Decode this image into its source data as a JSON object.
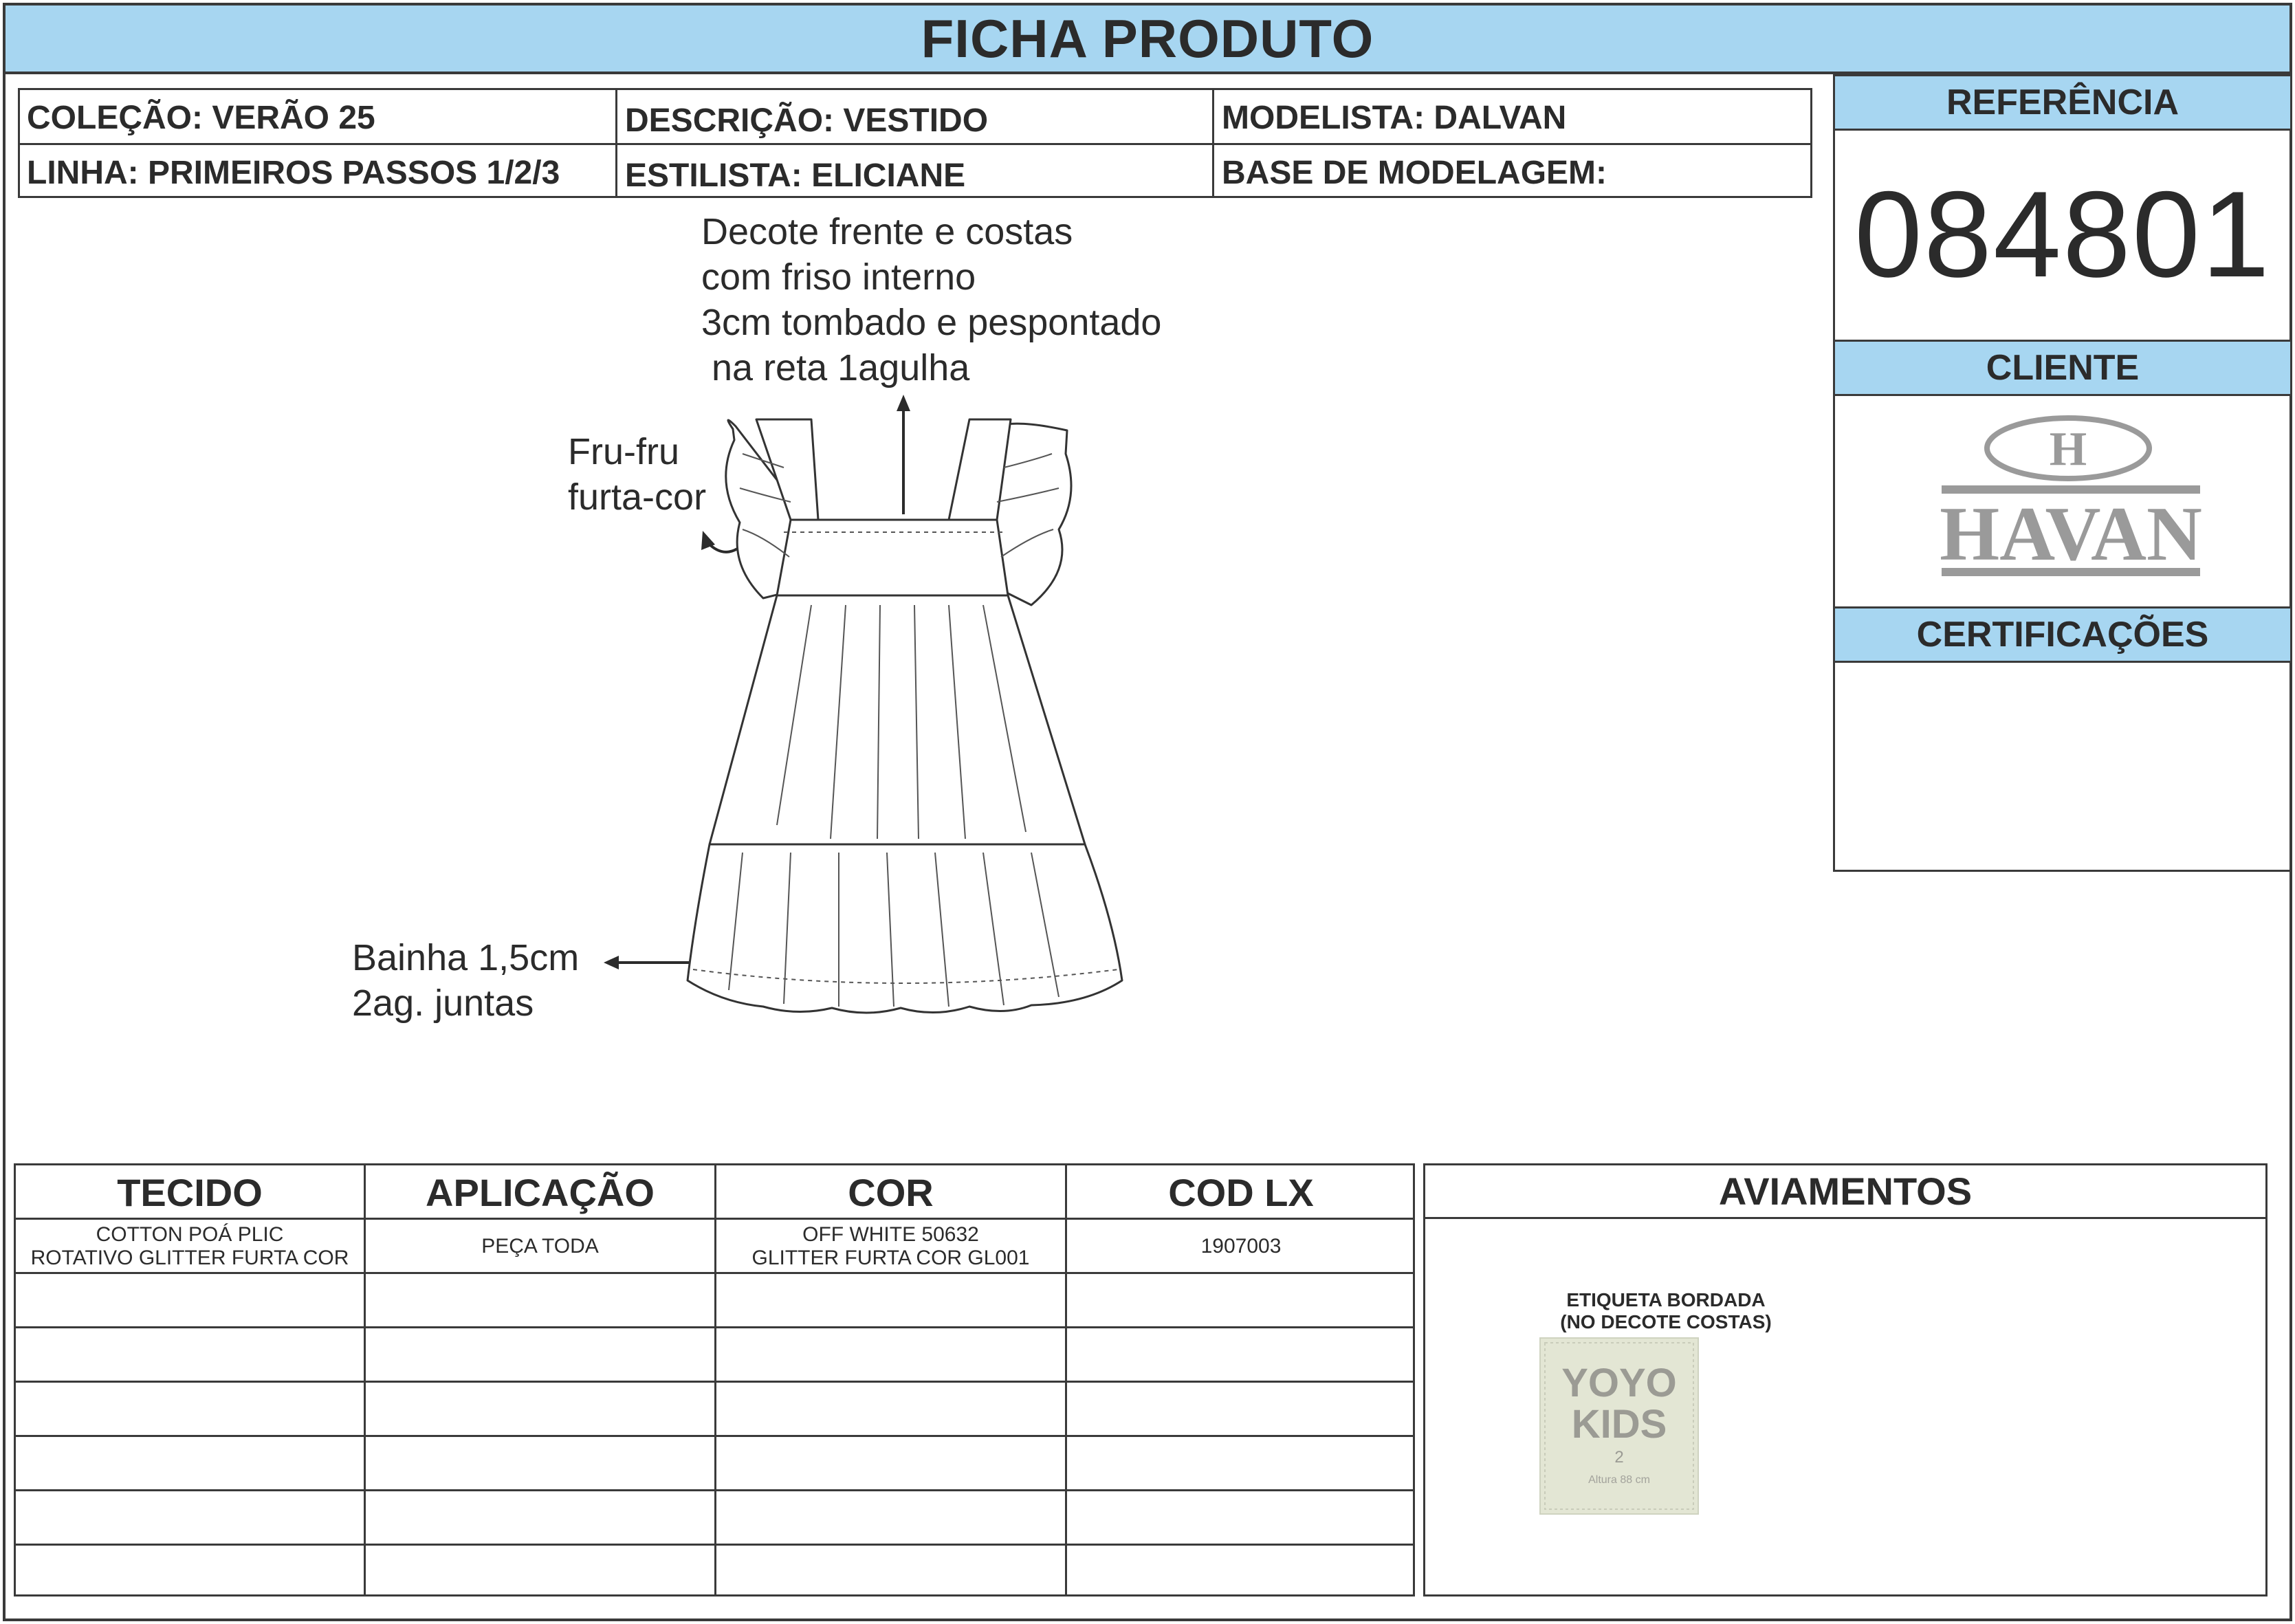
{
  "header": {
    "title": "FICHA PRODUTO"
  },
  "info": {
    "colecao": "COLEÇÃO: VERÃO 25",
    "descricao": "DESCRIÇÃO: VESTIDO",
    "modelista": "MODELISTA: DALVAN",
    "linha": "LINHA: PRIMEIROS PASSOS 1/2/3",
    "estilista": "ESTILISTA: ELICIANE",
    "base": "BASE DE MODELAGEM:"
  },
  "right_panel": {
    "referencia_label": "REFERÊNCIA",
    "referencia_value": "084801",
    "cliente_label": "CLIENTE",
    "cliente_logo_letter": "H",
    "cliente_logo_name": "HAVAN",
    "certificacoes_label": "CERTIFICAÇÕES"
  },
  "annotations": {
    "decote": "Decote frente e costas\ncom friso interno\n3cm tombado e pespontado\n na reta 1agulha",
    "frufru": "Fru-fru\nfurta-cor",
    "bainha": "Bainha 1,5cm\n2ag. juntas"
  },
  "materials_table": {
    "headers": [
      "TECIDO",
      "APLICAÇÃO",
      "COR",
      "COD LX"
    ],
    "rows": [
      [
        "COTTON POÁ PLIC\nROTATIVO GLITTER FURTA COR",
        "PEÇA TODA",
        "OFF WHITE 50632\nGLITTER FURTA COR GL001",
        "1907003"
      ]
    ]
  },
  "aviamentos": {
    "title": "AVIAMENTOS",
    "item_caption": "ETIQUETA BORDADA\n(NO DECOTE COSTAS)",
    "label_brand_1": "YOYO",
    "label_brand_2": "KIDS",
    "label_size": "2",
    "label_height": "Altura 88 cm"
  },
  "colors": {
    "header_blue": "#a7d6f1",
    "border": "#3a3a3a",
    "logo_gray": "#9a9a9a"
  },
  "icons": [
    "arrow-up-icon",
    "curved-arrow-icon",
    "arrow-left-icon"
  ]
}
